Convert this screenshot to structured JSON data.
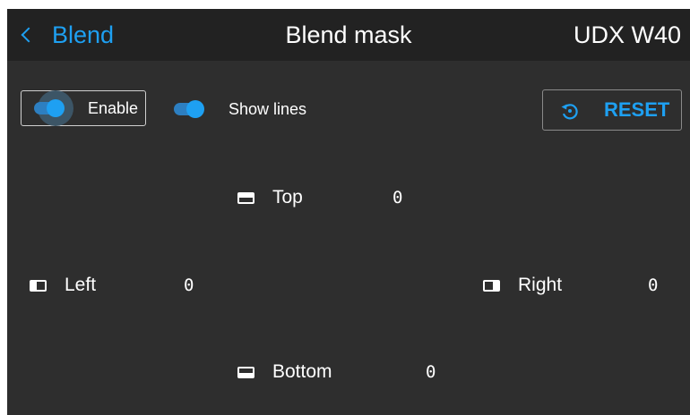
{
  "header": {
    "back_label": "Blend",
    "title": "Blend mask",
    "device": "UDX W40"
  },
  "controls": {
    "enable": {
      "label": "Enable",
      "on": true
    },
    "show_lines": {
      "label": "Show lines",
      "on": true
    },
    "reset": {
      "label": "RESET"
    }
  },
  "edges": {
    "top": {
      "label": "Top",
      "value": "0"
    },
    "left": {
      "label": "Left",
      "value": "0"
    },
    "right": {
      "label": "Right",
      "value": "0"
    },
    "bottom": {
      "label": "Bottom",
      "value": "0"
    }
  },
  "colors": {
    "accent": "#1ea0f2",
    "background": "#2e2e2e",
    "header": "#222222"
  },
  "icons": {
    "back": "chevron-left-icon",
    "reset": "reset-icon",
    "top": "top-edge-icon",
    "left": "left-edge-icon",
    "right": "right-edge-icon",
    "bottom": "bottom-edge-icon"
  }
}
